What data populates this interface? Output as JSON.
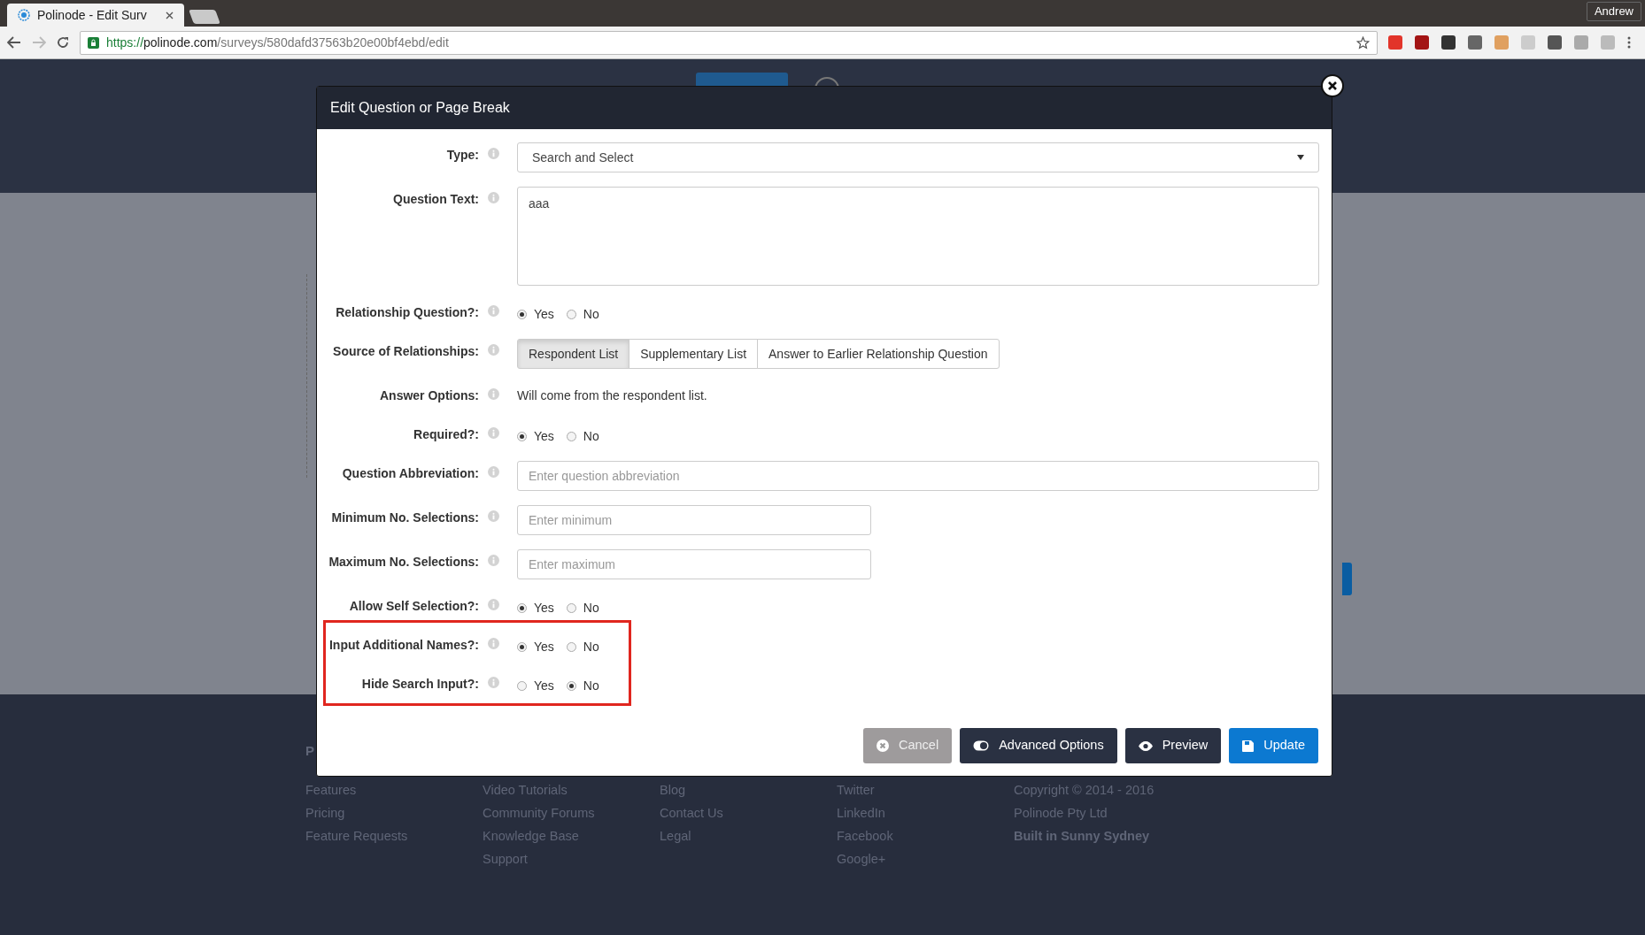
{
  "browser": {
    "tab_title": "Polinode - Edit Surv",
    "url_scheme": "https://",
    "url_host": "polinode.com",
    "url_path": "/surveys/580dafd37563b20e00bf4ebd/edit",
    "user": "Andrew"
  },
  "modal": {
    "title": "Edit Question or Page Break",
    "fields": [
      {
        "kind": "select",
        "label": "Type:",
        "value": "Search and Select"
      },
      {
        "kind": "textarea",
        "label": "Question Text:",
        "value": "aaa"
      },
      {
        "kind": "radio",
        "label": "Relationship Question?:",
        "options": [
          {
            "label": "Yes",
            "selected": true
          },
          {
            "label": "No",
            "selected": false
          }
        ]
      },
      {
        "kind": "segmented",
        "label": "Source of Relationships:",
        "options": [
          {
            "label": "Respondent List",
            "selected": true
          },
          {
            "label": "Supplementary List",
            "selected": false
          },
          {
            "label": "Answer to Earlier Relationship Question",
            "selected": false
          }
        ]
      },
      {
        "kind": "text",
        "label": "Answer Options:",
        "value": "Will come from the respondent list."
      },
      {
        "kind": "radio",
        "label": "Required?:",
        "options": [
          {
            "label": "Yes",
            "selected": true
          },
          {
            "label": "No",
            "selected": false
          }
        ]
      },
      {
        "kind": "input",
        "label": "Question Abbreviation:",
        "placeholder": "Enter question abbreviation",
        "wide": true
      },
      {
        "kind": "input",
        "label": "Minimum No. Selections:",
        "placeholder": "Enter minimum",
        "wide": false
      },
      {
        "kind": "input",
        "label": "Maximum No. Selections:",
        "placeholder": "Enter maximum",
        "wide": false
      },
      {
        "kind": "radio",
        "label": "Allow Self Selection?:",
        "options": [
          {
            "label": "Yes",
            "selected": true
          },
          {
            "label": "No",
            "selected": false
          }
        ]
      },
      {
        "kind": "radio",
        "label": "Input Additional Names?:",
        "highlighted": true,
        "options": [
          {
            "label": "Yes",
            "selected": true
          },
          {
            "label": "No",
            "selected": false
          }
        ]
      },
      {
        "kind": "radio",
        "label": "Hide Search Input?:",
        "highlighted": true,
        "options": [
          {
            "label": "Yes",
            "selected": false
          },
          {
            "label": "No",
            "selected": true
          }
        ]
      }
    ],
    "buttons": [
      {
        "kind": "cancel",
        "label": "Cancel"
      },
      {
        "kind": "advanced",
        "label": "Advanced Options"
      },
      {
        "kind": "preview",
        "label": "Preview"
      },
      {
        "kind": "update",
        "label": "Update"
      }
    ]
  },
  "footer": {
    "heading": "P",
    "columns": [
      [
        "Features",
        "Pricing",
        "Feature Requests"
      ],
      [
        "Video Tutorials",
        "Community Forums",
        "Knowledge Base",
        "Support"
      ],
      [
        "Blog",
        "Contact Us",
        "Legal"
      ],
      [
        "Twitter",
        "LinkedIn",
        "Facebook",
        "Google+"
      ],
      [
        "Copyright © 2014 - 2016",
        "Polinode Pty Ltd",
        "**Built in Sunny Sydney**"
      ]
    ]
  }
}
